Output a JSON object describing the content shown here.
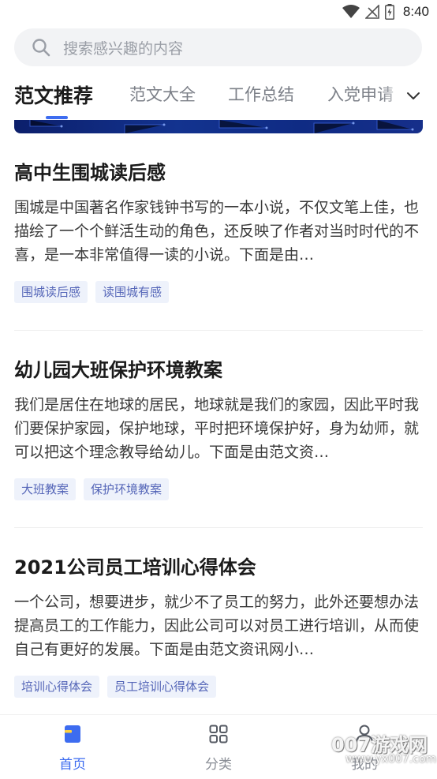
{
  "status_bar": {
    "time": "8:40",
    "icons": [
      "wifi-icon",
      "signal-icon",
      "battery-icon"
    ]
  },
  "search": {
    "placeholder": "搜索感兴趣的内容"
  },
  "tabs": [
    {
      "label": "范文推荐",
      "active": true
    },
    {
      "label": "范文大全",
      "active": false
    },
    {
      "label": "工作总结",
      "active": false
    },
    {
      "label": "入党申请",
      "active": false
    }
  ],
  "articles": [
    {
      "title": "高中生围城读后感",
      "summary": "围城是中国著名作家钱钟书写的一本小说，不仅文笔上佳，也描绘了一个个鲜活生动的角色，还反映了作者对当时时代的不喜，是一本非常值得一读的小说。下面是由…",
      "tags": [
        "围城读后感",
        "读围城有感"
      ]
    },
    {
      "title": "幼儿园大班保护环境教案",
      "summary": "我们是居住在地球的居民，地球就是我们的家园，因此平时我们要保护家园，保护地球，平时把环境保护好，身为幼师，就可以把这个理念教导给幼儿。下面是由范文资…",
      "tags": [
        "大班教案",
        "保护环境教案"
      ]
    },
    {
      "title": "2021公司员工培训心得体会",
      "summary": "一个公司，想要进步，就少不了员工的努力，此外还要想办法提高员工的工作能力，因此公司可以对员工进行培训，从而使自己有更好的发展。下面是由范文资讯网小…",
      "tags": [
        "培训心得体会",
        "员工培训心得体会"
      ]
    }
  ],
  "bottom_nav": [
    {
      "label": "首页",
      "icon": "home-icon",
      "active": true
    },
    {
      "label": "分类",
      "icon": "category-grid-icon",
      "active": false
    },
    {
      "label": "我的",
      "icon": "profile-icon",
      "active": false
    }
  ],
  "watermark": {
    "text": "007游戏网",
    "url_text": "www.yx007.com"
  },
  "colors": {
    "accent": "#3d6cf0",
    "tag_bg": "#eef2fb",
    "tag_text": "#5566b8",
    "banner": "#13338f"
  }
}
